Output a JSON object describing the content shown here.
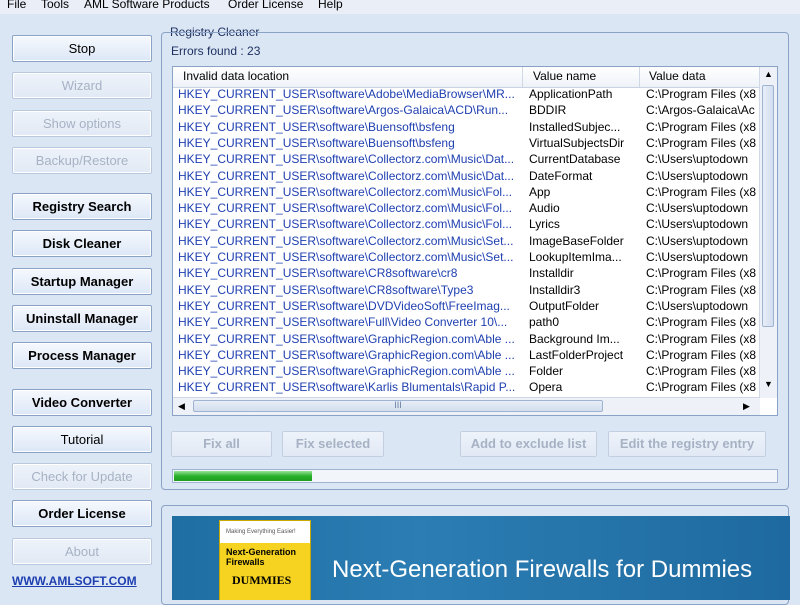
{
  "menu": [
    "File",
    "Tools",
    "AML Software Products",
    "Order License",
    "Help"
  ],
  "sidebar": {
    "buttons": [
      {
        "label": "Stop",
        "enabled": true,
        "bold": false
      },
      {
        "label": "Wizard",
        "enabled": false,
        "bold": false
      },
      {
        "label": "Show options",
        "enabled": false,
        "bold": false
      },
      {
        "label": "Backup/Restore",
        "enabled": false,
        "bold": false
      },
      {
        "label": "Registry Search",
        "enabled": true,
        "bold": true
      },
      {
        "label": "Disk Cleaner",
        "enabled": true,
        "bold": true
      },
      {
        "label": "Startup Manager",
        "enabled": true,
        "bold": true
      },
      {
        "label": "Uninstall Manager",
        "enabled": true,
        "bold": true
      },
      {
        "label": "Process Manager",
        "enabled": true,
        "bold": true
      },
      {
        "label": "Video Converter",
        "enabled": true,
        "bold": true
      },
      {
        "label": "Tutorial",
        "enabled": true,
        "bold": false
      },
      {
        "label": "Check for Update",
        "enabled": false,
        "bold": false
      },
      {
        "label": "Order License",
        "enabled": true,
        "bold": true
      },
      {
        "label": "About",
        "enabled": false,
        "bold": false
      }
    ],
    "website_link": "WWW.AMLSOFT.COM"
  },
  "registry_cleaner": {
    "title": "Registry Cleaner",
    "errors_found": "Errors found : 23",
    "columns": [
      "Invalid data location",
      "Value name",
      "Value data"
    ],
    "rows": [
      [
        "HKEY_CURRENT_USER\\software\\Adobe\\MediaBrowser\\MR...",
        "ApplicationPath",
        "C:\\Program Files (x8"
      ],
      [
        "HKEY_CURRENT_USER\\software\\Argos-Galaica\\ACD\\Run...",
        "BDDIR",
        "C:\\Argos-Galaica\\Ac"
      ],
      [
        "HKEY_CURRENT_USER\\software\\Buensoft\\bsfeng",
        "InstalledSubjec...",
        "C:\\Program Files (x8"
      ],
      [
        "HKEY_CURRENT_USER\\software\\Buensoft\\bsfeng",
        "VirtualSubjectsDir",
        "C:\\Program Files (x8"
      ],
      [
        "HKEY_CURRENT_USER\\software\\Collectorz.com\\Music\\Dat...",
        "CurrentDatabase",
        "C:\\Users\\uptodown"
      ],
      [
        "HKEY_CURRENT_USER\\software\\Collectorz.com\\Music\\Dat...",
        "DateFormat",
        "C:\\Users\\uptodown"
      ],
      [
        "HKEY_CURRENT_USER\\software\\Collectorz.com\\Music\\Fol...",
        "App",
        "C:\\Program Files (x8"
      ],
      [
        "HKEY_CURRENT_USER\\software\\Collectorz.com\\Music\\Fol...",
        "Audio",
        "C:\\Users\\uptodown"
      ],
      [
        "HKEY_CURRENT_USER\\software\\Collectorz.com\\Music\\Fol...",
        "Lyrics",
        "C:\\Users\\uptodown"
      ],
      [
        "HKEY_CURRENT_USER\\software\\Collectorz.com\\Music\\Set...",
        "ImageBaseFolder",
        "C:\\Users\\uptodown"
      ],
      [
        "HKEY_CURRENT_USER\\software\\Collectorz.com\\Music\\Set...",
        "LookupItemIma...",
        "C:\\Users\\uptodown"
      ],
      [
        "HKEY_CURRENT_USER\\software\\CR8software\\cr8",
        "Installdir",
        "C:\\Program Files (x8"
      ],
      [
        "HKEY_CURRENT_USER\\software\\CR8software\\Type3",
        "Installdir3",
        "C:\\Program Files (x8"
      ],
      [
        "HKEY_CURRENT_USER\\software\\DVDVideoSoft\\FreeImag...",
        "OutputFolder",
        "C:\\Users\\uptodown"
      ],
      [
        "HKEY_CURRENT_USER\\software\\Full\\Video Converter 10\\...",
        "path0",
        "C:\\Program Files (x8"
      ],
      [
        "HKEY_CURRENT_USER\\software\\GraphicRegion.com\\Able ...",
        "Background Im...",
        "C:\\Program Files (x8"
      ],
      [
        "HKEY_CURRENT_USER\\software\\GraphicRegion.com\\Able ...",
        "LastFolderProject",
        "C:\\Program Files (x8"
      ],
      [
        "HKEY_CURRENT_USER\\software\\GraphicRegion.com\\Able ...",
        "Folder",
        "C:\\Program Files (x8"
      ],
      [
        "HKEY_CURRENT_USER\\software\\Karlis Blumentals\\Rapid P...",
        "Opera",
        "C:\\Program Files (x8"
      ]
    ],
    "scroll_thumb_glyph": "III",
    "actions": [
      "Fix all",
      "Fix selected",
      "Add to exclude list",
      "Edit the registry entry"
    ],
    "progress_fraction": 0.23
  },
  "ad": {
    "book_tiny": "Making Everything Easier!",
    "book_line1": "Next-Generation",
    "book_line2": "Firewalls",
    "book_brand": "DUMMIES",
    "banner_text": "Next-Generation Firewalls for Dummies"
  },
  "colors": {
    "link": "#1e3fb0",
    "progress": "#27b127",
    "ad_bg": "#2b7db3"
  }
}
